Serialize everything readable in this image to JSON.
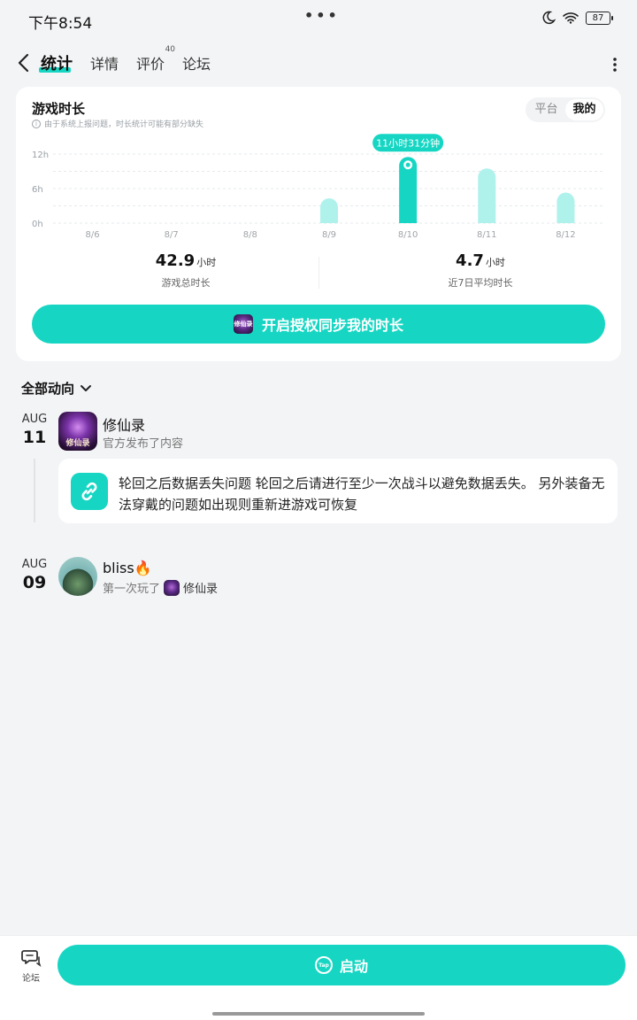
{
  "status_bar": {
    "time": "下午8:54",
    "dots": "•••",
    "battery": "87"
  },
  "nav": {
    "tabs": [
      {
        "label": "统计",
        "active": true
      },
      {
        "label": "详情"
      },
      {
        "label": "评价",
        "badge": "40"
      },
      {
        "label": "论坛"
      }
    ]
  },
  "stats": {
    "title": "游戏时长",
    "note": "由于系统上报问题，时长统计可能有部分缺失",
    "toggle": [
      "平台",
      "我的"
    ],
    "toggle_active": "我的",
    "total_value": "42.9",
    "total_unit": "小时",
    "total_label": "游戏总时长",
    "avg_value": "4.7",
    "avg_unit": "小时",
    "avg_label": "近7日平均时长",
    "sync_label": "开启授权同步我的时长",
    "game_icon_text": "修仙录"
  },
  "chart_data": {
    "type": "bar",
    "categories": [
      "8/6",
      "8/7",
      "8/8",
      "8/9",
      "8/10",
      "8/11",
      "8/12"
    ],
    "values": [
      0,
      0,
      0,
      4.3,
      11.5,
      9.5,
      5.3
    ],
    "y_tick_labels": [
      "12h",
      "6h",
      "0h"
    ],
    "y_ticks": [
      12,
      6,
      0
    ],
    "ylim": [
      0,
      12
    ],
    "highlight_index": 4,
    "highlight_label": "11小时31分钟",
    "bar_color": "#aff2ec",
    "highlight_color": "#16d6c3"
  },
  "feed": {
    "header": "全部动向",
    "items": [
      {
        "month": "AUG",
        "day": "11",
        "name": "修仙录",
        "sub": "官方发布了内容",
        "avatar_text": "修仙录",
        "post": "轮回之后数据丢失问题 轮回之后请进行至少一次战斗以避免数据丢失。 另外装备无法穿戴的问题如出现则重新进游戏可恢复"
      },
      {
        "month": "AUG",
        "day": "09",
        "name": "bliss🔥",
        "sub": "第一次玩了",
        "game": "修仙录"
      }
    ]
  },
  "bottom": {
    "forum_label": "论坛",
    "launch_label": "启动",
    "tap_text": "Tap"
  }
}
